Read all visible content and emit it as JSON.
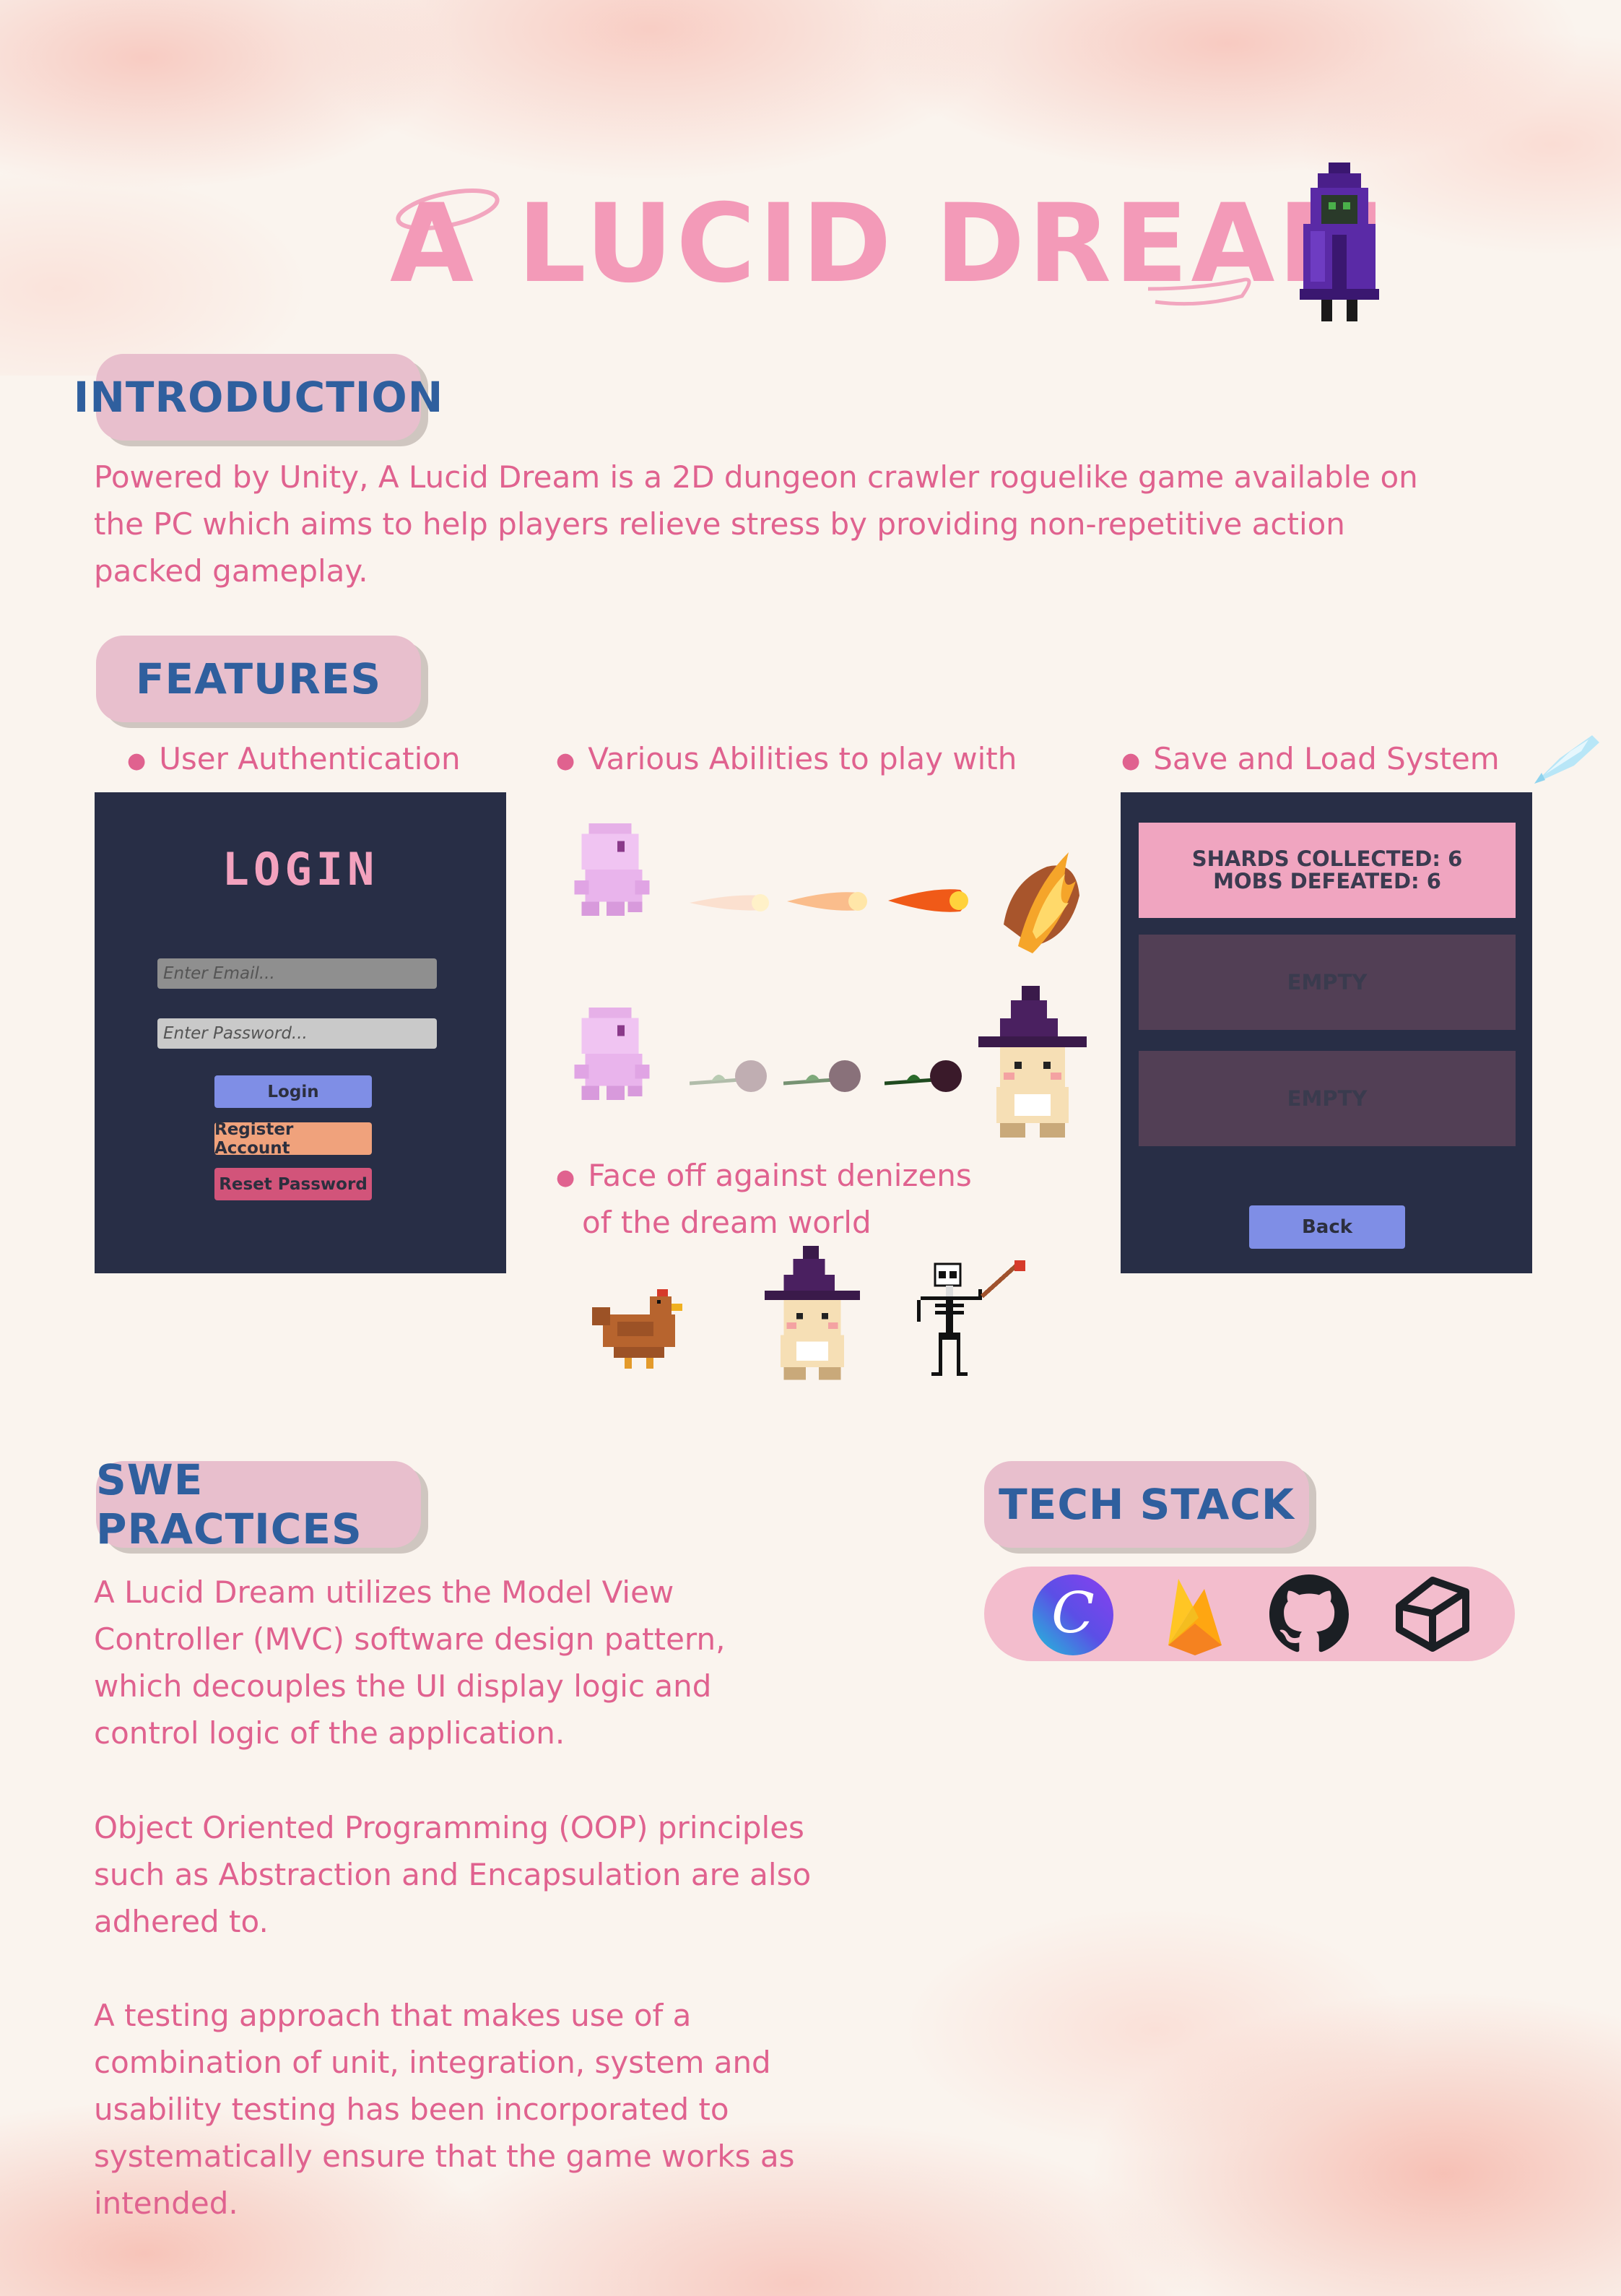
{
  "title": "A LUCID DREAM",
  "introduction": {
    "heading": "INTRODUCTION",
    "lines": [
      "Powered by Unity, A Lucid Dream is a 2D dungeon crawler roguelike game available on",
      "the PC which aims to help players relieve stress by providing non-repetitive action",
      "packed gameplay."
    ]
  },
  "features": {
    "heading": "FEATURES",
    "bullets": {
      "auth": "User Authentication",
      "abilities": "Various Abilities to play with",
      "save": "Save and Load System",
      "enemies_line1": "Face off against denizens",
      "enemies_line2": "of the dream world"
    },
    "login_panel": {
      "title": "LOGIN",
      "email_placeholder": "Enter Email...",
      "password_placeholder": "Enter Password...",
      "login_button": "Login",
      "register_button": "Register Account",
      "reset_button": "Reset Password"
    },
    "save_panel": {
      "slot1_line1": "SHARDS COLLECTED: 6",
      "slot1_line2": "MOBS DEFEATED: 6",
      "slot2": "EMPTY",
      "slot3": "EMPTY",
      "back_button": "Back"
    }
  },
  "swe_practices": {
    "heading": "SWE PRACTICES",
    "para1": [
      "A Lucid Dream utilizes the Model View",
      "Controller (MVC) software design pattern,",
      "which decouples the UI display logic and",
      "control logic of the application."
    ],
    "para2": [
      "Object Oriented Programming (OOP) principles",
      "such as Abstraction and Encapsulation are also",
      "adhered to."
    ],
    "para3": [
      "A testing approach that makes use of a",
      "combination of unit, integration, system and",
      "usability testing has been incorporated to",
      "systematically ensure that the game works as",
      "intended."
    ]
  },
  "tech_stack": {
    "heading": "TECH STACK",
    "icons": [
      "canva-icon",
      "firebase-icon",
      "github-icon",
      "unity-icon"
    ]
  },
  "colors": {
    "background": "#faf4ee",
    "accent_pink": "#e0628f",
    "title_pink": "#f39ab8",
    "pill_bg": "#e8bfcd",
    "heading_blue": "#2f5f9e",
    "panel_dark": "#282e46"
  }
}
